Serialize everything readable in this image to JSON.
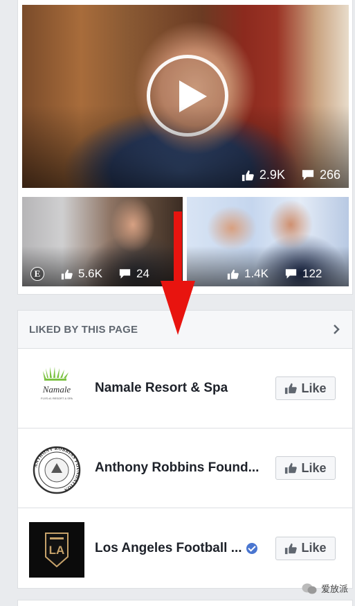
{
  "videos": {
    "main": {
      "likes": "2.9K",
      "comments": "266"
    },
    "left": {
      "likes": "5.6K",
      "comments": "24",
      "badge": "E"
    },
    "right": {
      "likes": "1.4K",
      "comments": "122"
    }
  },
  "liked_section": {
    "title": "LIKED BY THIS PAGE",
    "pages": [
      {
        "name": "Namale Resort & Spa",
        "button": "Like",
        "logo_text": "Namale",
        "logo_subtext": "FIJI'S #1 RESORT & SPA"
      },
      {
        "name": "Anthony Robbins Found...",
        "button": "Like",
        "logo_text": "ANTHONY ROBBINS FOUNDATION"
      },
      {
        "name": "Los Angeles Football ...",
        "button": "Like",
        "verified": true,
        "logo_text": "LAFC"
      }
    ]
  },
  "watermark": {
    "text": "爱放派"
  },
  "colors": {
    "accent_red": "#e8140f",
    "verified_blue": "#4a76d0",
    "header_bg": "#f6f7f9"
  }
}
